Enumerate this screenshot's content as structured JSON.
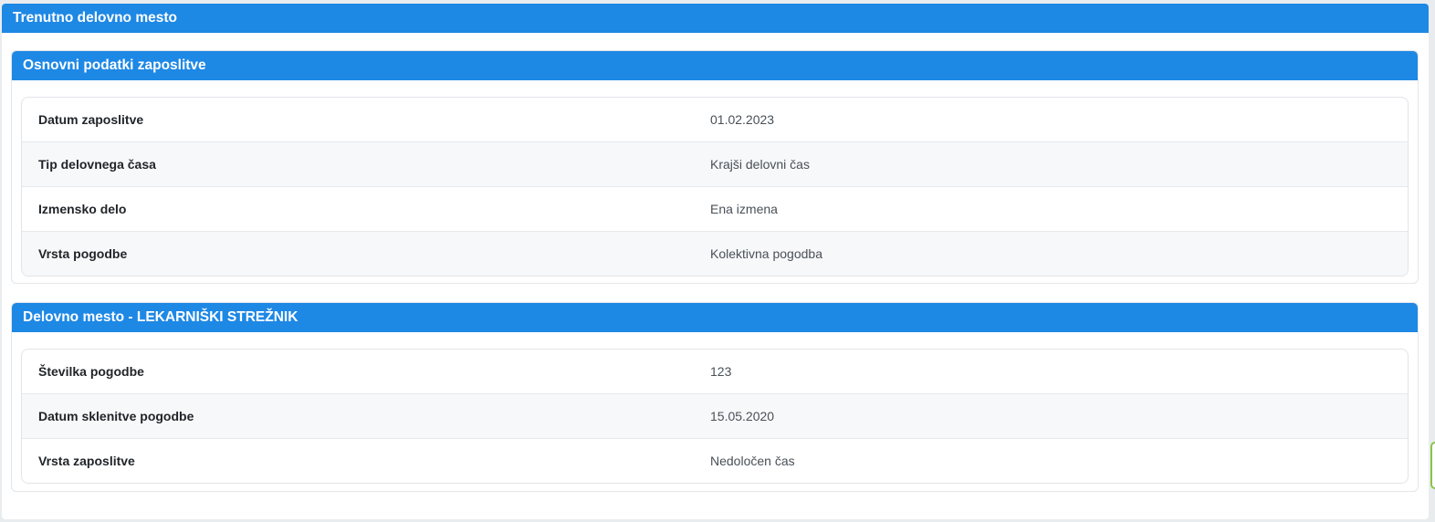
{
  "page": {
    "title": "Trenutno delovno mesto"
  },
  "sections": [
    {
      "title": "Osnovni podatki zaposlitve",
      "rows": [
        {
          "label": "Datum zaposlitve",
          "value": "01.02.2023"
        },
        {
          "label": "Tip delovnega časa",
          "value": "Krajši delovni čas"
        },
        {
          "label": "Izmensko delo",
          "value": "Ena izmena"
        },
        {
          "label": "Vrsta pogodbe",
          "value": "Kolektivna pogodba"
        }
      ]
    },
    {
      "title": "Delovno mesto - LEKARNIŠKI STREŽNIK",
      "rows": [
        {
          "label": "Številka pogodbe",
          "value": "123"
        },
        {
          "label": "Datum sklenitve pogodbe",
          "value": "15.05.2020"
        },
        {
          "label": "Vrsta zaposlitve",
          "value": "Nedoločen čas"
        }
      ]
    }
  ],
  "colors": {
    "header_blue": "#1e88e5",
    "edge_accent": "#8bc34a"
  }
}
